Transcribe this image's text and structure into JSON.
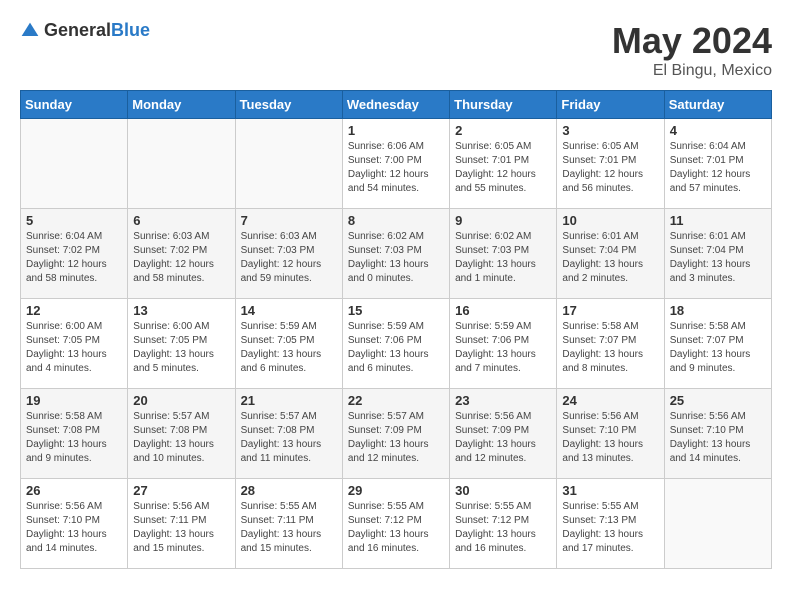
{
  "header": {
    "logo_general": "General",
    "logo_blue": "Blue",
    "month": "May 2024",
    "location": "El Bingu, Mexico"
  },
  "days_of_week": [
    "Sunday",
    "Monday",
    "Tuesday",
    "Wednesday",
    "Thursday",
    "Friday",
    "Saturday"
  ],
  "weeks": [
    [
      {
        "day": "",
        "info": ""
      },
      {
        "day": "",
        "info": ""
      },
      {
        "day": "",
        "info": ""
      },
      {
        "day": "1",
        "info": "Sunrise: 6:06 AM\nSunset: 7:00 PM\nDaylight: 12 hours\nand 54 minutes."
      },
      {
        "day": "2",
        "info": "Sunrise: 6:05 AM\nSunset: 7:01 PM\nDaylight: 12 hours\nand 55 minutes."
      },
      {
        "day": "3",
        "info": "Sunrise: 6:05 AM\nSunset: 7:01 PM\nDaylight: 12 hours\nand 56 minutes."
      },
      {
        "day": "4",
        "info": "Sunrise: 6:04 AM\nSunset: 7:01 PM\nDaylight: 12 hours\nand 57 minutes."
      }
    ],
    [
      {
        "day": "5",
        "info": "Sunrise: 6:04 AM\nSunset: 7:02 PM\nDaylight: 12 hours\nand 58 minutes."
      },
      {
        "day": "6",
        "info": "Sunrise: 6:03 AM\nSunset: 7:02 PM\nDaylight: 12 hours\nand 58 minutes."
      },
      {
        "day": "7",
        "info": "Sunrise: 6:03 AM\nSunset: 7:03 PM\nDaylight: 12 hours\nand 59 minutes."
      },
      {
        "day": "8",
        "info": "Sunrise: 6:02 AM\nSunset: 7:03 PM\nDaylight: 13 hours\nand 0 minutes."
      },
      {
        "day": "9",
        "info": "Sunrise: 6:02 AM\nSunset: 7:03 PM\nDaylight: 13 hours\nand 1 minute."
      },
      {
        "day": "10",
        "info": "Sunrise: 6:01 AM\nSunset: 7:04 PM\nDaylight: 13 hours\nand 2 minutes."
      },
      {
        "day": "11",
        "info": "Sunrise: 6:01 AM\nSunset: 7:04 PM\nDaylight: 13 hours\nand 3 minutes."
      }
    ],
    [
      {
        "day": "12",
        "info": "Sunrise: 6:00 AM\nSunset: 7:05 PM\nDaylight: 13 hours\nand 4 minutes."
      },
      {
        "day": "13",
        "info": "Sunrise: 6:00 AM\nSunset: 7:05 PM\nDaylight: 13 hours\nand 5 minutes."
      },
      {
        "day": "14",
        "info": "Sunrise: 5:59 AM\nSunset: 7:05 PM\nDaylight: 13 hours\nand 6 minutes."
      },
      {
        "day": "15",
        "info": "Sunrise: 5:59 AM\nSunset: 7:06 PM\nDaylight: 13 hours\nand 6 minutes."
      },
      {
        "day": "16",
        "info": "Sunrise: 5:59 AM\nSunset: 7:06 PM\nDaylight: 13 hours\nand 7 minutes."
      },
      {
        "day": "17",
        "info": "Sunrise: 5:58 AM\nSunset: 7:07 PM\nDaylight: 13 hours\nand 8 minutes."
      },
      {
        "day": "18",
        "info": "Sunrise: 5:58 AM\nSunset: 7:07 PM\nDaylight: 13 hours\nand 9 minutes."
      }
    ],
    [
      {
        "day": "19",
        "info": "Sunrise: 5:58 AM\nSunset: 7:08 PM\nDaylight: 13 hours\nand 9 minutes."
      },
      {
        "day": "20",
        "info": "Sunrise: 5:57 AM\nSunset: 7:08 PM\nDaylight: 13 hours\nand 10 minutes."
      },
      {
        "day": "21",
        "info": "Sunrise: 5:57 AM\nSunset: 7:08 PM\nDaylight: 13 hours\nand 11 minutes."
      },
      {
        "day": "22",
        "info": "Sunrise: 5:57 AM\nSunset: 7:09 PM\nDaylight: 13 hours\nand 12 minutes."
      },
      {
        "day": "23",
        "info": "Sunrise: 5:56 AM\nSunset: 7:09 PM\nDaylight: 13 hours\nand 12 minutes."
      },
      {
        "day": "24",
        "info": "Sunrise: 5:56 AM\nSunset: 7:10 PM\nDaylight: 13 hours\nand 13 minutes."
      },
      {
        "day": "25",
        "info": "Sunrise: 5:56 AM\nSunset: 7:10 PM\nDaylight: 13 hours\nand 14 minutes."
      }
    ],
    [
      {
        "day": "26",
        "info": "Sunrise: 5:56 AM\nSunset: 7:10 PM\nDaylight: 13 hours\nand 14 minutes."
      },
      {
        "day": "27",
        "info": "Sunrise: 5:56 AM\nSunset: 7:11 PM\nDaylight: 13 hours\nand 15 minutes."
      },
      {
        "day": "28",
        "info": "Sunrise: 5:55 AM\nSunset: 7:11 PM\nDaylight: 13 hours\nand 15 minutes."
      },
      {
        "day": "29",
        "info": "Sunrise: 5:55 AM\nSunset: 7:12 PM\nDaylight: 13 hours\nand 16 minutes."
      },
      {
        "day": "30",
        "info": "Sunrise: 5:55 AM\nSunset: 7:12 PM\nDaylight: 13 hours\nand 16 minutes."
      },
      {
        "day": "31",
        "info": "Sunrise: 5:55 AM\nSunset: 7:13 PM\nDaylight: 13 hours\nand 17 minutes."
      },
      {
        "day": "",
        "info": ""
      }
    ]
  ]
}
